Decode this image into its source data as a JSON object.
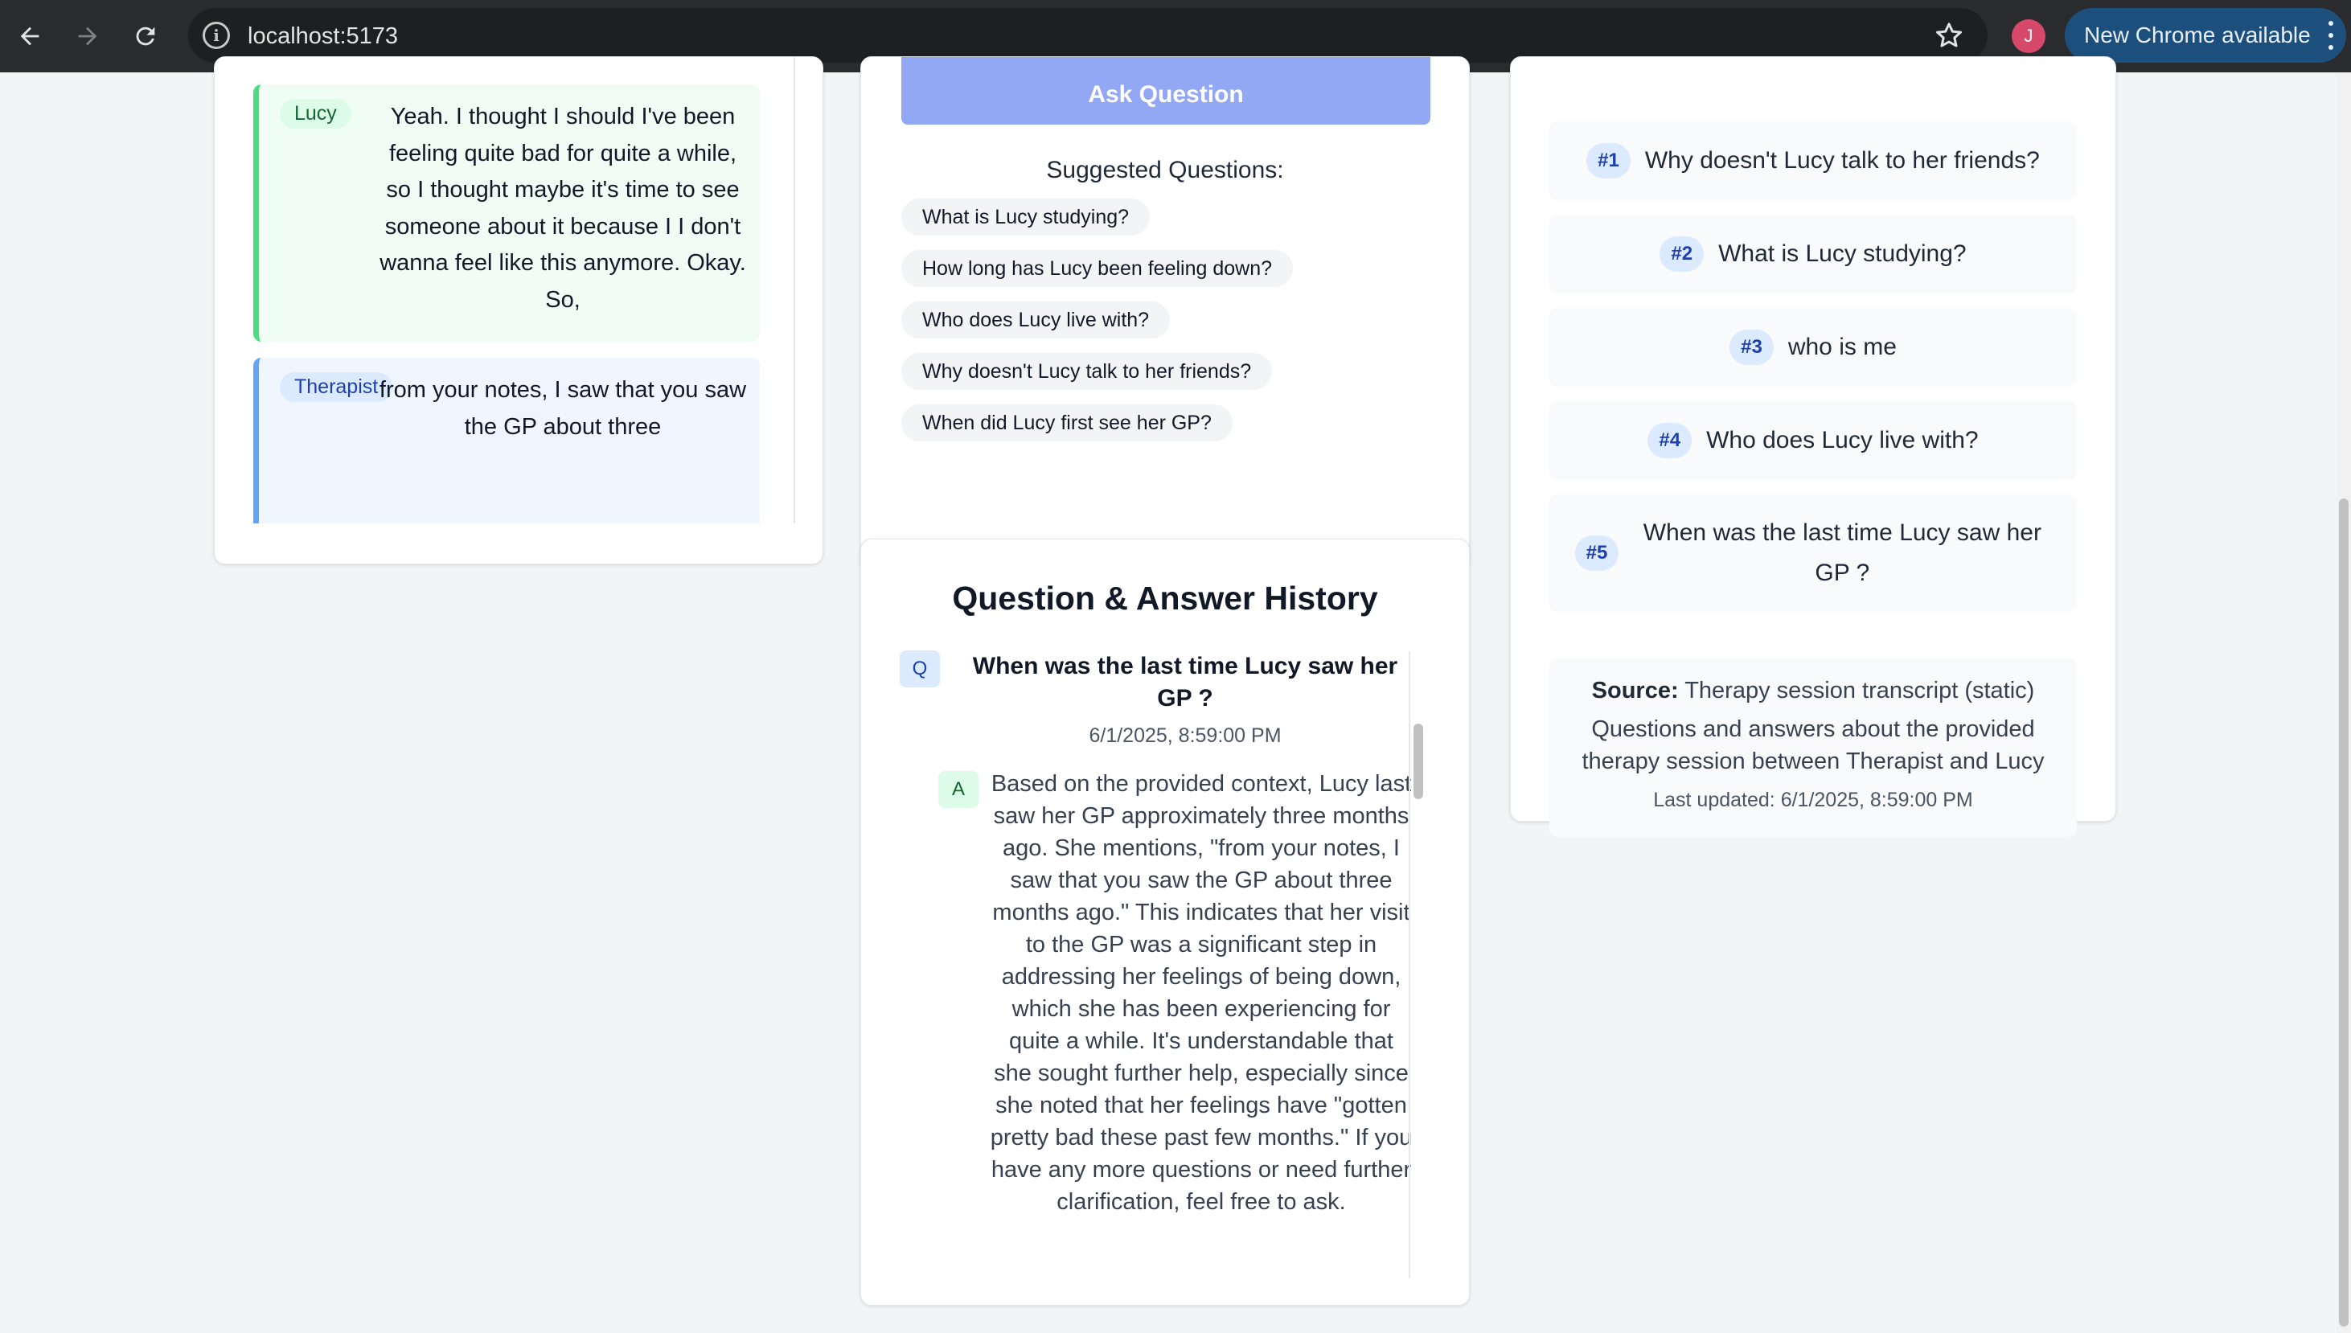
{
  "browser": {
    "url": "localhost:5173",
    "profile_initial": "J",
    "update_label": "New Chrome available"
  },
  "transcript": {
    "messages": [
      {
        "speaker": "Lucy",
        "text": "Yeah. I thought I should I've been feeling quite bad for quite a while, so I thought maybe it's time to see someone about it because I I don't wanna feel like this anymore. Okay. So,"
      },
      {
        "speaker": "Therapist",
        "text": "from your notes, I saw that you saw the GP about three"
      }
    ]
  },
  "ask": {
    "button_label": "Ask Question",
    "suggested_title": "Suggested Questions:",
    "suggestions": [
      "What is Lucy studying?",
      "How long has Lucy been feeling down?",
      "Who does Lucy live with?",
      "Why doesn't Lucy talk to her friends?",
      "When did Lucy first see her GP?"
    ]
  },
  "history": {
    "title": "Question & Answer History",
    "q_tag": "Q",
    "a_tag": "A",
    "question": "When was the last time Lucy saw her GP ?",
    "timestamp": "6/1/2025, 8:59:00 PM",
    "answer": "Based on the provided context, Lucy last saw her GP approximately three months ago. She mentions, \"from your notes, I saw that you saw the GP about three months ago.\" This indicates that her visit to the GP was a significant step in addressing her feelings of being down, which she has been experiencing for quite a while. It's understandable that she sought further help, especially since she noted that her feelings have \"gotten pretty bad these past few months.\" If you have any more questions or need further clarification, feel free to ask."
  },
  "recent_questions": [
    {
      "num": "#1",
      "text": "Why doesn't Lucy talk to her friends?"
    },
    {
      "num": "#2",
      "text": "What is Lucy studying?"
    },
    {
      "num": "#3",
      "text": "who is me"
    },
    {
      "num": "#4",
      "text": "Who does Lucy live with?"
    },
    {
      "num": "#5",
      "text": "When was the last time Lucy saw her GP ?"
    }
  ],
  "source": {
    "label": "Source:",
    "value": "Therapy session transcript (static)",
    "description": "Questions and answers about the provided therapy session between Therapist and Lucy",
    "updated": "Last updated: 6/1/2025, 8:59:00 PM"
  }
}
